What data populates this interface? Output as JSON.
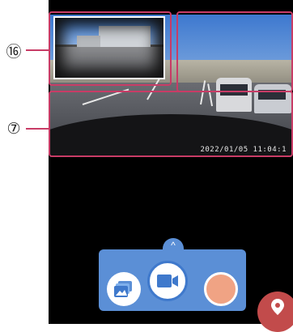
{
  "callouts": {
    "pip_label": "⑯",
    "main_label": "⑦"
  },
  "video": {
    "timestamp": "2022/01/05 11:04:1"
  },
  "controls": {
    "expand_label": "^",
    "gallery_icon": "gallery-icon",
    "record_icon": "video-camera-icon",
    "shutter_icon": "record-dot",
    "map_icon": "map-pin-icon"
  },
  "colors": {
    "highlight": "#c83c66",
    "panel": "#5b8fd6",
    "record_border": "#3f79cc",
    "shutter": "#f0a384",
    "map_button": "#c24b4b"
  }
}
